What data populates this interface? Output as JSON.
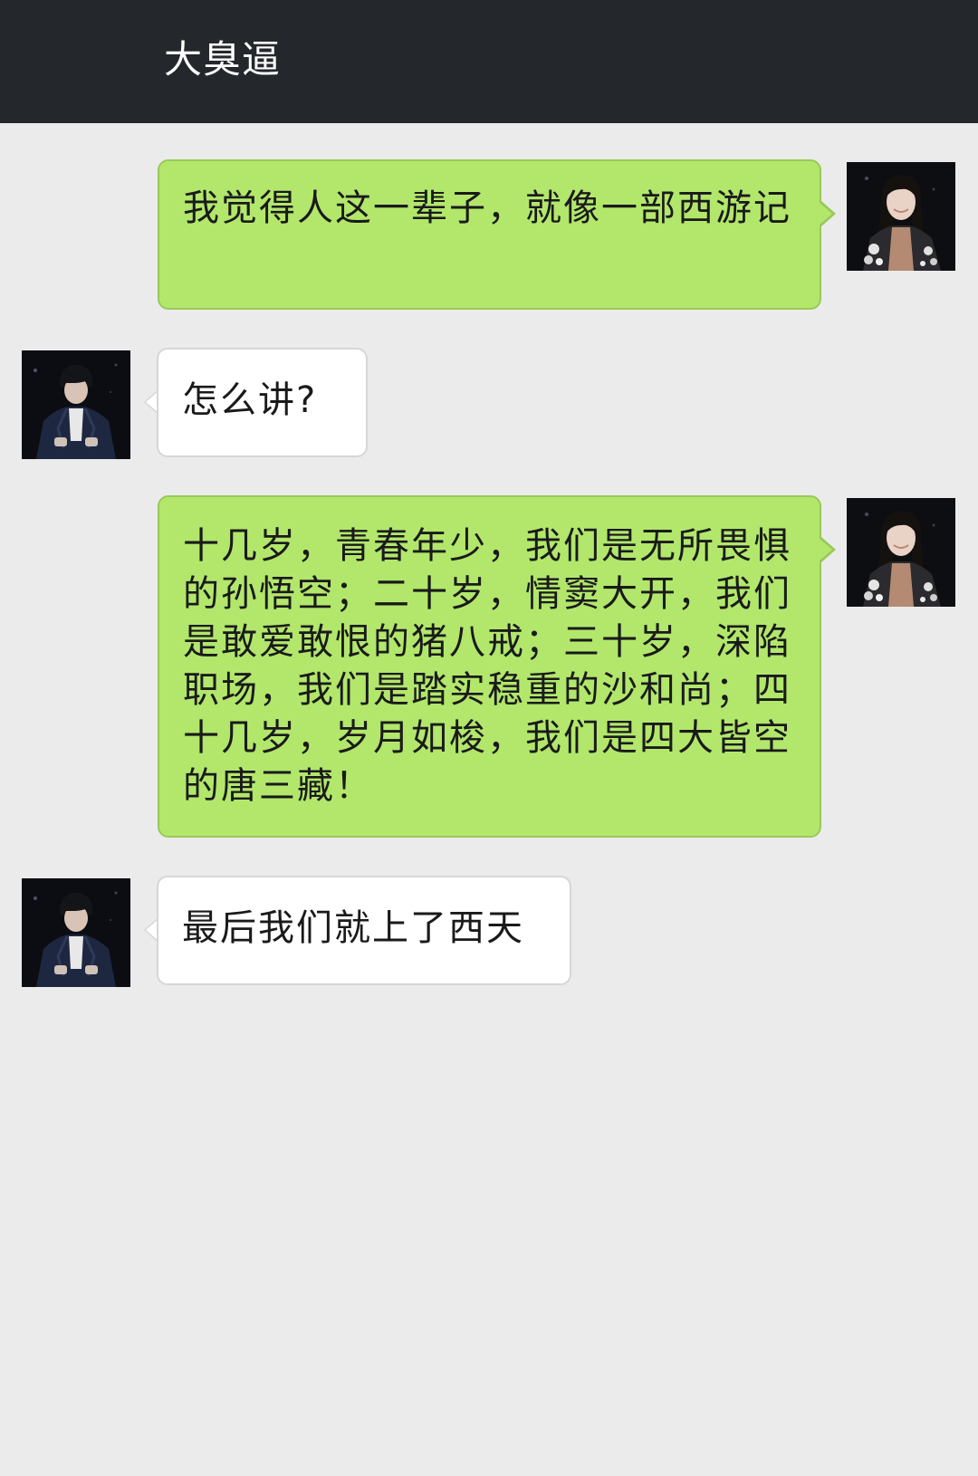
{
  "header": {
    "title": "大臭逼"
  },
  "messages": [
    {
      "side": "right",
      "text": "我觉得人这一辈子，就像一部西游记",
      "avatar": "female-avatar"
    },
    {
      "side": "left",
      "text": "怎么讲?",
      "avatar": "male-avatar"
    },
    {
      "side": "right",
      "text": "十几岁，青春年少，我们是无所畏惧的孙悟空；二十岁，情窦大开，我们是敢爱敢恨的猪八戒；三十岁，深陷职场，我们是踏实稳重的沙和尚；四十几岁，岁月如梭，我们是四大皆空的唐三藏！",
      "avatar": "female-avatar"
    },
    {
      "side": "left",
      "text": "最后我们就上了西天",
      "avatar": "male-avatar"
    }
  ],
  "colors": {
    "header_bg": "#24282c",
    "chat_bg": "#ebebeb",
    "sent_bubble": "#b2e76c",
    "received_bubble": "#ffffff"
  }
}
